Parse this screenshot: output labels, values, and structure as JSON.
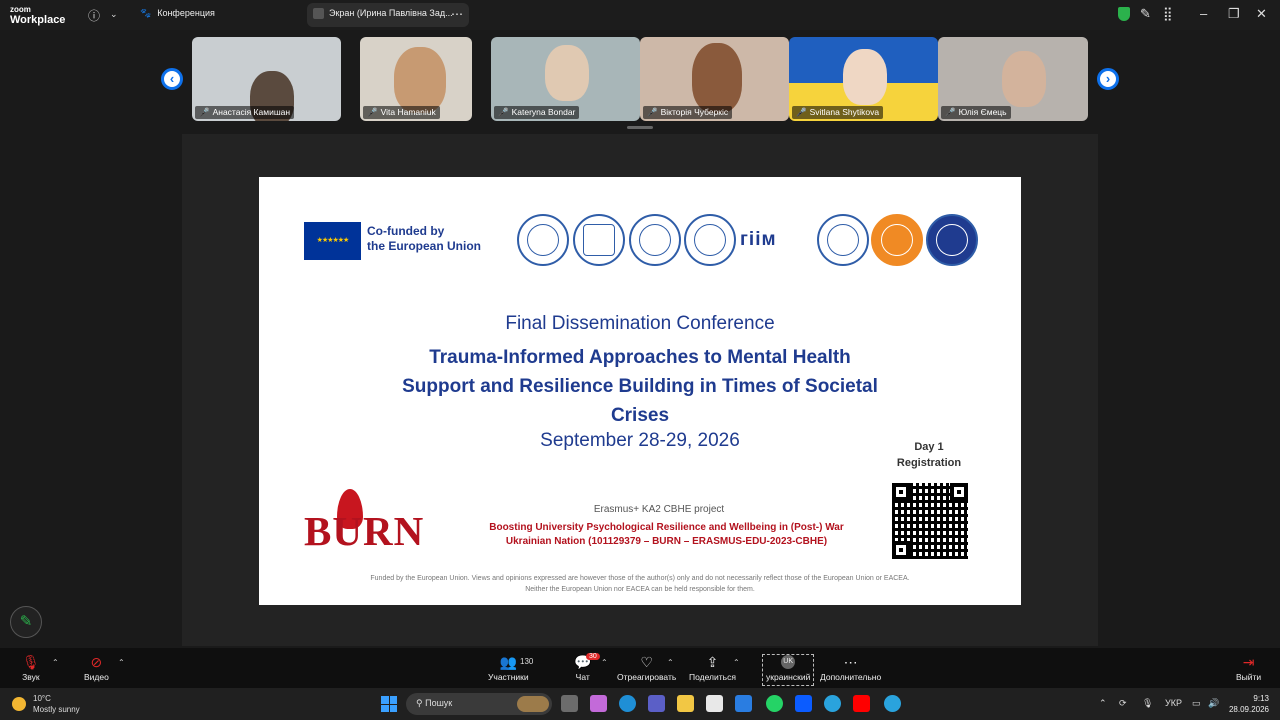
{
  "app": {
    "logo_line1": "zoom",
    "logo_line2": "Workplace",
    "meeting_title": "Конференция",
    "share_tab_title": "Экран (Ирина Павлівна Зад..."
  },
  "participants": [
    {
      "name": "Анастасія Камишан",
      "muted": true
    },
    {
      "name": "Vita Hamaniuk",
      "muted": true
    },
    {
      "name": "Kateryna Bondar",
      "muted": true
    },
    {
      "name": "Вікторія Чуберкіс",
      "muted": true
    },
    {
      "name": "Svitlana Shytikova",
      "muted": true
    },
    {
      "name": "Юлія Ємець",
      "muted": true
    }
  ],
  "slide": {
    "eu_line1": "Co-funded by",
    "eu_line2": "the European Union",
    "title_line1": "Final Dissemination Conference",
    "title_main": "Trauma-Informed Approaches to Mental Health Support and Resilience Building in Times of Societal Crises",
    "date": "September 28-29, 2026",
    "day_label": "Day 1",
    "registration_label": "Registration",
    "burn_logo": "BURN",
    "erasmus": "Erasmus+ KA2 CBHE project",
    "project_title": "Boosting University Psychological Resilience and Wellbeing in (Post-) War Ukrainian Nation (101129379 – BURN – ERASMUS-EDU-2023-CBHE)",
    "disclaimer_line1": "Funded by the European Union. Views and opinions expressed are however those of the author(s) only and do not necessarily reflect those of the European Union or EACEA.",
    "disclaimer_line2": "Neither the European Union nor EACEA can be held responsible for them.",
    "partner_logo_text": "гіім"
  },
  "toolbar": {
    "audio": "Звук",
    "video": "Видео",
    "participants": "Участники",
    "participants_count": "130",
    "chat": "Чат",
    "chat_badge": "30",
    "react": "Отреагировать",
    "share": "Поделиться",
    "language_code": "UK",
    "language": "украинский",
    "more": "Дополнительно",
    "leave": "Выйти"
  },
  "taskbar": {
    "temperature": "10°C",
    "weather": "Mostly sunny",
    "search_placeholder": "Пошук",
    "lang": "УКР",
    "time": "9:13",
    "date": "28.09.2026"
  },
  "colors": {
    "zoom_blue": "#0e71eb",
    "slide_blue": "#1f3b8f",
    "burn_red": "#b3121e",
    "mute_red": "#e02828"
  }
}
